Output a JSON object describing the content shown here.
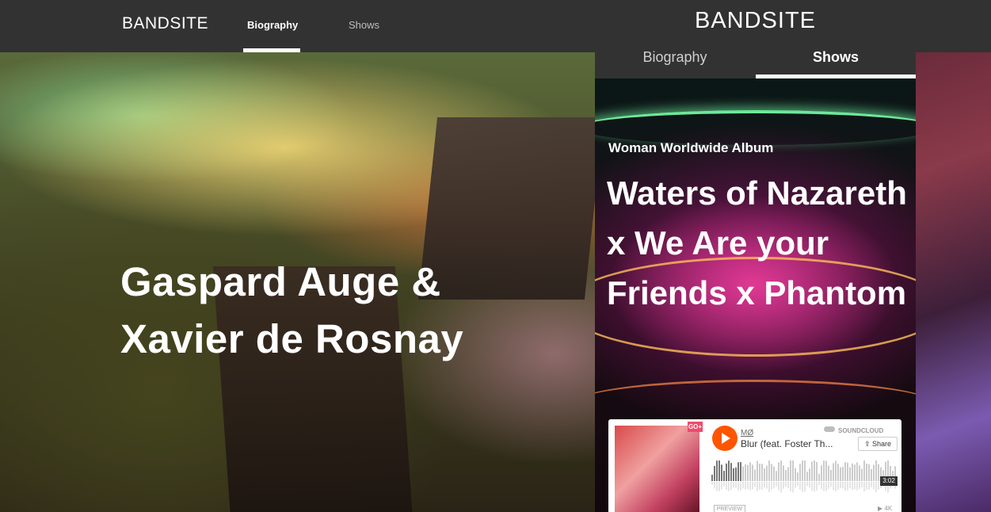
{
  "desktop": {
    "logo": "BANDSITE",
    "tabs": [
      {
        "label": "Biography",
        "active": true
      },
      {
        "label": "Shows",
        "active": false
      }
    ],
    "hero_title": "Gaspard Auge & Xavier de Rosnay"
  },
  "mobile": {
    "logo": "BANDSITE",
    "tabs": [
      {
        "label": "Biography",
        "active": false
      },
      {
        "label": "Shows",
        "active": true
      }
    ],
    "hero_subtitle": "Woman Worldwide Album",
    "hero_title": "Waters of Nazareth x We Are your Friends x Phantom"
  },
  "soundcloud": {
    "artist": "MØ",
    "track": "Blur (feat. Foster Th...",
    "brand": "SOUNDCLOUD",
    "share_label": "Share",
    "badge": "GO+",
    "duration": "3:02",
    "preview_label": "PREVIEW",
    "plays": "4K"
  },
  "colors": {
    "header_bg": "#323232",
    "soundcloud_orange": "#ff5500",
    "text": "#ffffff"
  }
}
